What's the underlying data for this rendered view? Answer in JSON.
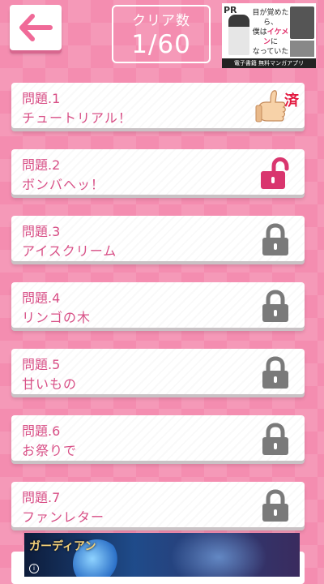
{
  "header": {
    "clear_label": "クリア数",
    "clear_count": "1/60"
  },
  "top_ad": {
    "pr": "PR",
    "line1": "目が覚めたら、",
    "line2_a": "僕は",
    "line2_b": "イケメン",
    "line2_c": "に",
    "line3": "なっていた",
    "footer": "電子書籍 無料マンガアプリ"
  },
  "questions": [
    {
      "number": "問題.1",
      "title": "チュートリアル！",
      "status": "done",
      "done_badge": "済"
    },
    {
      "number": "問題.2",
      "title": "ボンバヘッ！",
      "status": "unlocked"
    },
    {
      "number": "問題.3",
      "title": "アイスクリーム",
      "status": "locked"
    },
    {
      "number": "問題.4",
      "title": "リンゴの木",
      "status": "locked"
    },
    {
      "number": "問題.5",
      "title": "甘いもの",
      "status": "locked"
    },
    {
      "number": "問題.6",
      "title": "お祭りで",
      "status": "locked"
    },
    {
      "number": "問題.7",
      "title": "ファンレター",
      "status": "locked"
    }
  ],
  "icons": {
    "back": "back-arrow-icon",
    "done": "thumbs-up-icon",
    "unlocked": "unlocked-padlock-icon",
    "locked": "padlock-icon"
  },
  "colors": {
    "background": "#f48db0",
    "accent": "#d84f86",
    "lock_locked": "#7a7a7a",
    "lock_unlocked": "#d9356e"
  },
  "bottom_ad": {
    "title": "ガーディアン",
    "info": "i"
  }
}
